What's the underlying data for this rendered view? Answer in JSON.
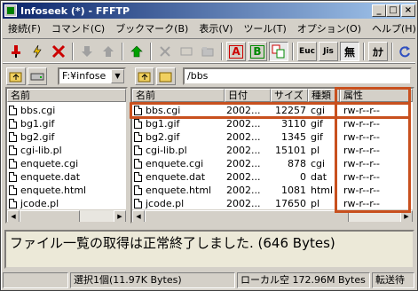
{
  "window": {
    "title": "Infoseek (*) - FFFTP"
  },
  "menu": [
    "接続(F)",
    "コマンド(C)",
    "ブックマーク(B)",
    "表示(V)",
    "ツール(T)",
    "オプション(O)",
    "ヘルプ(H)"
  ],
  "toolbar": {
    "ascii_label": "A",
    "binary_label": "B",
    "euc_label": "Euc",
    "jis_label": "Jis",
    "none_label": "無",
    "kana_label": "ｶﾅ"
  },
  "local": {
    "drive": "F:",
    "path": "F:¥infose",
    "header_name": "名前",
    "files": [
      "bbs.cgi",
      "bg1.gif",
      "bg2.gif",
      "cgi-lib.pl",
      "enquete.cgi",
      "enquete.dat",
      "enquete.html",
      "jcode.pl"
    ]
  },
  "remote": {
    "path": "/bbs",
    "headers": {
      "name": "名前",
      "date": "日付",
      "size": "サイズ",
      "type": "種類",
      "attr": "属性"
    },
    "files": [
      {
        "name": "bbs.cgi",
        "date": "2002...",
        "size": "12257",
        "type": "cgi",
        "attr": "rw-r--r--"
      },
      {
        "name": "bg1.gif",
        "date": "2002...",
        "size": "3110",
        "type": "gif",
        "attr": "rw-r--r--"
      },
      {
        "name": "bg2.gif",
        "date": "2002...",
        "size": "1345",
        "type": "gif",
        "attr": "rw-r--r--"
      },
      {
        "name": "cgi-lib.pl",
        "date": "2002...",
        "size": "15101",
        "type": "pl",
        "attr": "rw-r--r--"
      },
      {
        "name": "enquete.cgi",
        "date": "2002...",
        "size": "878",
        "type": "cgi",
        "attr": "rw-r--r--"
      },
      {
        "name": "enquete.dat",
        "date": "2002...",
        "size": "0",
        "type": "dat",
        "attr": "rw-r--r--"
      },
      {
        "name": "enquete.html",
        "date": "2002...",
        "size": "1081",
        "type": "html",
        "attr": "rw-r--r--"
      },
      {
        "name": "jcode.pl",
        "date": "2002...",
        "size": "17650",
        "type": "pl",
        "attr": "rw-r--r--"
      }
    ]
  },
  "log": {
    "message": "ファイル一覧の取得は正常終了しました. (646 Bytes)"
  },
  "status": {
    "selection": "選択1個(11.97K Bytes)",
    "local_free": "ローカル空 172.96M Bytes",
    "transfer": "転送待"
  },
  "colors": {
    "highlight": "#c8501e",
    "titlebar": "#0a246a"
  }
}
